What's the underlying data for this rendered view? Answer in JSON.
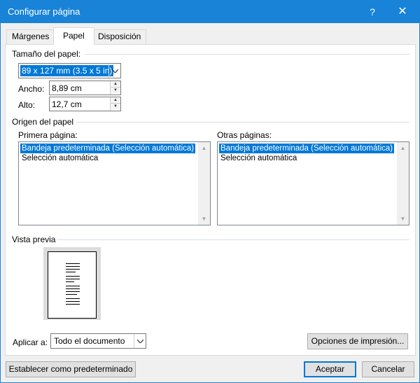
{
  "window": {
    "title": "Configurar página",
    "help_label": "?",
    "close_label": "✕"
  },
  "tabs": [
    {
      "label": "Márgenes"
    },
    {
      "label": "Papel"
    },
    {
      "label": "Disposición"
    }
  ],
  "active_tab": "Papel",
  "paper_size": {
    "section_label": "Tamaño del papel:",
    "selected": "89 x 127 mm (3.5 x 5 in)",
    "width_label": "Ancho:",
    "width_value": "8,89 cm",
    "height_label": "Alto:",
    "height_value": "12,7 cm"
  },
  "paper_source": {
    "section_label": "Origen del papel",
    "first_page": {
      "label": "Primera página:",
      "items": [
        "Bandeja predeterminada (Selección automática)",
        "Selección automática"
      ],
      "selected_index": 0
    },
    "other_pages": {
      "label": "Otras páginas:",
      "items": [
        "Bandeja predeterminada (Selección automática)",
        "Selección automática"
      ],
      "selected_index": 0
    }
  },
  "preview": {
    "section_label": "Vista previa"
  },
  "apply_to": {
    "label": "Aplicar a:",
    "value": "Todo el documento"
  },
  "buttons": {
    "print_options": "Opciones de impresión...",
    "set_default": "Establecer como predeterminado",
    "ok": "Aceptar",
    "cancel": "Cancelar"
  },
  "icons": {
    "dropdown": "chevron-down-icon",
    "spin_up": "arrow-up-icon",
    "spin_down": "arrow-down-icon",
    "scroll_up": "scroll-up-icon",
    "scroll_down": "scroll-down-icon"
  },
  "colors": {
    "titlebar": "#1883d7",
    "selection": "#0078d7"
  }
}
